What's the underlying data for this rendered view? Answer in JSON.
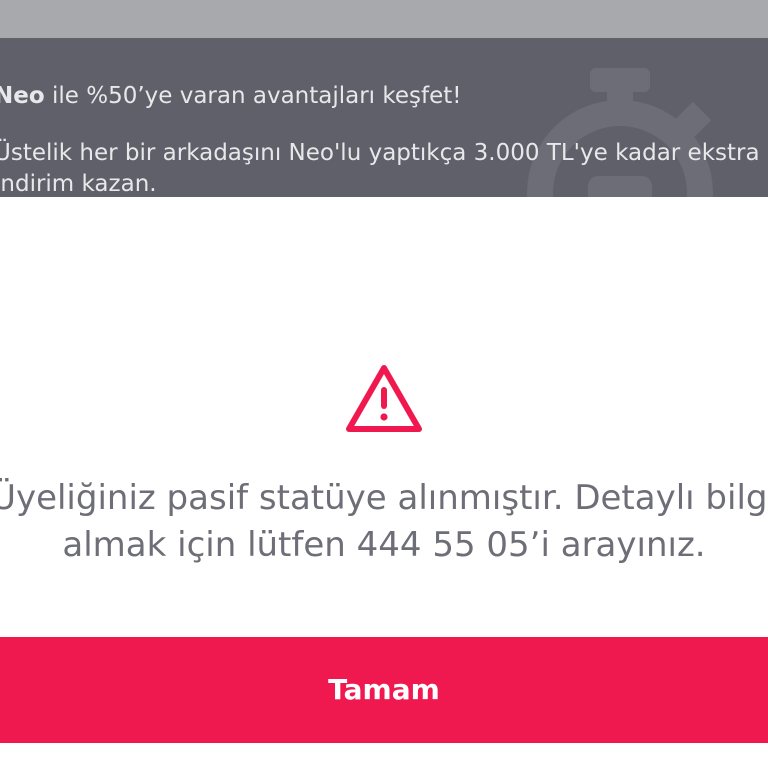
{
  "banner": {
    "brand": "Neo",
    "headline_rest": " ile %50’ye varan avantajları keşfet!",
    "paragraph": "Üstelik her bir arkadaşını Neo'lu yaptıkça 3.000 TL'ye kadar ekstra indirim kazan."
  },
  "dialog": {
    "icon": "warning-triangle-icon",
    "message": "Üyeliğiniz pasif statüye alınmıştır. Detaylı bilgi almak için lütfen 444 55 05’i arayınız.",
    "ok_label": "Tamam"
  },
  "colors": {
    "accent": "#f0194f",
    "banner_bg": "#5f6069",
    "topbar_bg": "#a8a9ad",
    "message_text": "#6e6e78"
  }
}
